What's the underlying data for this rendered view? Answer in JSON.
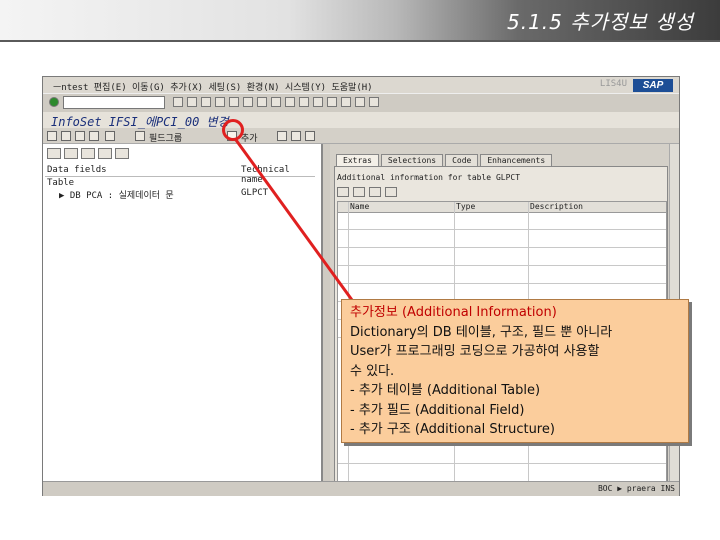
{
  "slide": {
    "title": "5.1.5 추가정보 생성"
  },
  "sap_window": {
    "menu_text": "ㅡntest 편집(E) 이동(G) 추가(X) 세팅(S) 환경(N) 시스템(Y) 도움말(H)",
    "window_faint_label": "LIS4U",
    "sap_logo": "SAP",
    "title": "InfoSet IFSI_에PCI_00 변경",
    "appbar_label_1": "필드그룹",
    "appbar_label_2": "추가",
    "left_pane": {
      "col1_header": "Data fields",
      "col2_header": "Technical name",
      "tree_root": "Table",
      "tree_row_label": "DB PCA : 실제데이터 문",
      "tree_row_tech": "GLPCT"
    },
    "right_pane": {
      "tabs": [
        "Extras",
        "Selections",
        "Code",
        "Enhancements"
      ],
      "info_text": "Additional information for table GLPCT",
      "grid_headers": [
        "Name",
        "Type",
        "Description"
      ]
    },
    "status_text": "BOC  ▶ praera  INS"
  },
  "callout": {
    "title": "추가정보 (Additional Information)",
    "line1": "Dictionary의 DB 테이블, 구조, 필드 뿐 아니라",
    "line2": "User가 프로그래밍 코딩으로 가공하여 사용할",
    "line3": "수 있다.",
    "line4": "- 추가 테이블 (Additional Table)",
    "line5": "- 추가 필드 (Additional Field)",
    "line6": "- 추가 구조 (Additional Structure)"
  },
  "colors": {
    "callout_bg": "#fbcd9c",
    "highlight_red": "#e02020",
    "sap_blue": "#1d4e96"
  }
}
